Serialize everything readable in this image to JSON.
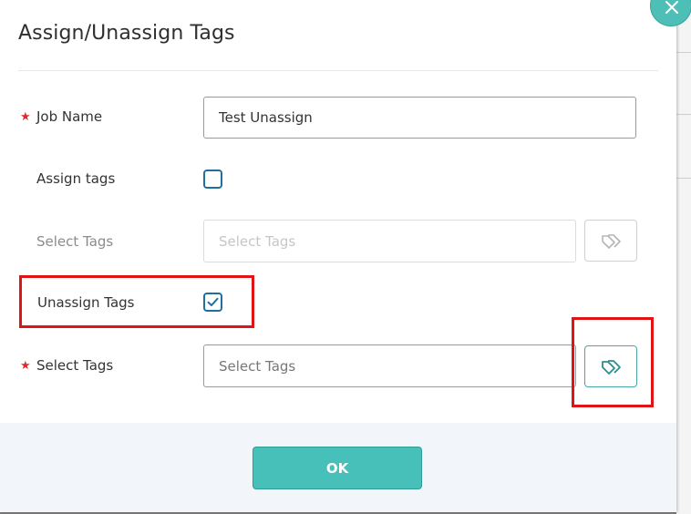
{
  "dialog": {
    "title": "Assign/Unassign Tags",
    "ok_label": "OK"
  },
  "form": {
    "job_name": {
      "label": "Job Name",
      "value": "Test Unassign",
      "required": true
    },
    "assign_tags": {
      "label": "Assign tags",
      "checked": false
    },
    "assign_select": {
      "label": "Select Tags",
      "placeholder": "Select Tags",
      "disabled": true
    },
    "unassign_tags": {
      "label": "Unassign Tags",
      "checked": true
    },
    "unassign_select": {
      "label": "Select Tags",
      "placeholder": "Select Tags",
      "required": true
    }
  },
  "required_marker": "★",
  "colors": {
    "accent": "#48c0ba",
    "required": "#e02a2a",
    "highlight": "#e01414",
    "checkbox": "#1f6f9f"
  },
  "icons": {
    "close": "close-icon",
    "tag": "tag-icon",
    "check": "checkmark-icon"
  }
}
